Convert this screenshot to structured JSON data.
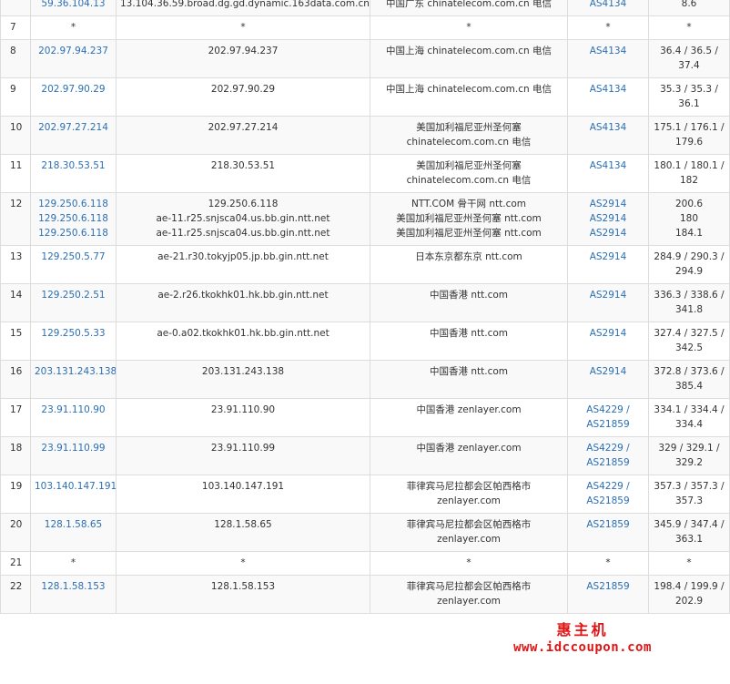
{
  "rows": [
    {
      "hop": "",
      "ips": [
        "59.36.104.13"
      ],
      "hosts": [
        "13.104.36.59.broad.dg.gd.dynamic.163data.com.cn"
      ],
      "locs": [
        "中国广东 chinatelecom.com.cn 电信"
      ],
      "asns": [
        "AS4134"
      ],
      "rtts": [
        "8.6"
      ]
    },
    {
      "hop": "7",
      "ips": [
        "*"
      ],
      "hosts": [
        "*"
      ],
      "locs": [
        "*"
      ],
      "asns": [
        "*"
      ],
      "rtts": [
        "*"
      ]
    },
    {
      "hop": "8",
      "ips": [
        "202.97.94.237"
      ],
      "hosts": [
        "202.97.94.237"
      ],
      "locs": [
        "中国上海 chinatelecom.com.cn 电信"
      ],
      "asns": [
        "AS4134"
      ],
      "rtts": [
        "36.4 / 36.5 / 37.4"
      ]
    },
    {
      "hop": "9",
      "ips": [
        "202.97.90.29"
      ],
      "hosts": [
        "202.97.90.29"
      ],
      "locs": [
        "中国上海 chinatelecom.com.cn 电信"
      ],
      "asns": [
        "AS4134"
      ],
      "rtts": [
        "35.3 / 35.3 / 36.1"
      ]
    },
    {
      "hop": "10",
      "ips": [
        "202.97.27.214"
      ],
      "hosts": [
        "202.97.27.214"
      ],
      "locs": [
        "美国加利福尼亚州圣何塞 chinatelecom.com.cn 电信"
      ],
      "asns": [
        "AS4134"
      ],
      "rtts": [
        "175.1 / 176.1 / 179.6"
      ]
    },
    {
      "hop": "11",
      "ips": [
        "218.30.53.51"
      ],
      "hosts": [
        "218.30.53.51"
      ],
      "locs": [
        "美国加利福尼亚州圣何塞 chinatelecom.com.cn 电信"
      ],
      "asns": [
        "AS4134"
      ],
      "rtts": [
        "180.1 / 180.1 / 182"
      ]
    },
    {
      "hop": "12",
      "ips": [
        "129.250.6.118",
        "129.250.6.118",
        "129.250.6.118"
      ],
      "hosts": [
        "129.250.6.118",
        "ae-11.r25.snjsca04.us.bb.gin.ntt.net",
        "ae-11.r25.snjsca04.us.bb.gin.ntt.net"
      ],
      "locs": [
        "NTT.COM 骨干网 ntt.com",
        "美国加利福尼亚州圣何塞 ntt.com",
        "美国加利福尼亚州圣何塞 ntt.com"
      ],
      "asns": [
        "AS2914",
        "AS2914",
        "AS2914"
      ],
      "rtts": [
        "200.6",
        "180",
        "184.1"
      ]
    },
    {
      "hop": "13",
      "ips": [
        "129.250.5.77"
      ],
      "hosts": [
        "ae-21.r30.tokyjp05.jp.bb.gin.ntt.net"
      ],
      "locs": [
        "日本东京都东京 ntt.com"
      ],
      "asns": [
        "AS2914"
      ],
      "rtts": [
        "284.9 / 290.3 / 294.9"
      ]
    },
    {
      "hop": "14",
      "ips": [
        "129.250.2.51"
      ],
      "hosts": [
        "ae-2.r26.tkokhk01.hk.bb.gin.ntt.net"
      ],
      "locs": [
        "中国香港 ntt.com"
      ],
      "asns": [
        "AS2914"
      ],
      "rtts": [
        "336.3 / 338.6 / 341.8"
      ]
    },
    {
      "hop": "15",
      "ips": [
        "129.250.5.33"
      ],
      "hosts": [
        "ae-0.a02.tkokhk01.hk.bb.gin.ntt.net"
      ],
      "locs": [
        "中国香港 ntt.com"
      ],
      "asns": [
        "AS2914"
      ],
      "rtts": [
        "327.4 / 327.5 / 342.5"
      ]
    },
    {
      "hop": "16",
      "ips": [
        "203.131.243.138"
      ],
      "hosts": [
        "203.131.243.138"
      ],
      "locs": [
        "中国香港 ntt.com"
      ],
      "asns": [
        "AS2914"
      ],
      "rtts": [
        "372.8 / 373.6 / 385.4"
      ]
    },
    {
      "hop": "17",
      "ips": [
        "23.91.110.90"
      ],
      "hosts": [
        "23.91.110.90"
      ],
      "locs": [
        "中国香港 zenlayer.com"
      ],
      "asns": [
        "AS4229 /",
        "AS21859"
      ],
      "rtts": [
        "334.1 / 334.4 / 334.4"
      ]
    },
    {
      "hop": "18",
      "ips": [
        "23.91.110.99"
      ],
      "hosts": [
        "23.91.110.99"
      ],
      "locs": [
        "中国香港 zenlayer.com"
      ],
      "asns": [
        "AS4229 /",
        "AS21859"
      ],
      "rtts": [
        "329 / 329.1 / 329.2"
      ]
    },
    {
      "hop": "19",
      "ips": [
        "103.140.147.191"
      ],
      "hosts": [
        "103.140.147.191"
      ],
      "locs": [
        "菲律宾马尼拉都会区帕西格市 zenlayer.com"
      ],
      "asns": [
        "AS4229 /",
        "AS21859"
      ],
      "rtts": [
        "357.3 / 357.3 / 357.3"
      ]
    },
    {
      "hop": "20",
      "ips": [
        "128.1.58.65"
      ],
      "hosts": [
        "128.1.58.65"
      ],
      "locs": [
        "菲律宾马尼拉都会区帕西格市 zenlayer.com"
      ],
      "asns": [
        "AS21859"
      ],
      "rtts": [
        "345.9 / 347.4 / 363.1"
      ]
    },
    {
      "hop": "21",
      "ips": [
        "*"
      ],
      "hosts": [
        "*"
      ],
      "locs": [
        "*"
      ],
      "asns": [
        "*"
      ],
      "rtts": [
        "*"
      ]
    },
    {
      "hop": "22",
      "ips": [
        "128.1.58.153"
      ],
      "hosts": [
        "128.1.58.153"
      ],
      "locs": [
        "菲律宾马尼拉都会区帕西格市 zenlayer.com"
      ],
      "asns": [
        "AS21859"
      ],
      "rtts": [
        "198.4 / 199.9 / 202.9"
      ]
    }
  ],
  "watermark": {
    "line1": "惠主机",
    "line2": "www.idccoupon.com"
  },
  "colors": {
    "link": "#2a6fb5",
    "border": "#dddddd",
    "stripe": "#f9f9f9",
    "watermark": "#e01414"
  }
}
